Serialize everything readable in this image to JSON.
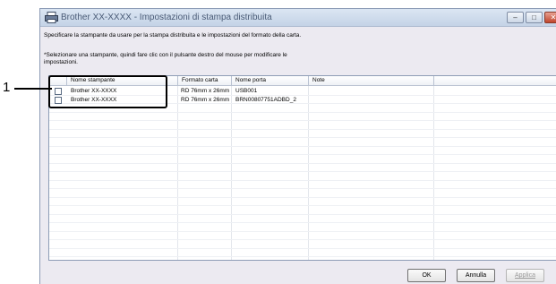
{
  "callout": {
    "number": "1"
  },
  "window": {
    "title": "Brother  XX-XXXX - Impostazioni di stampa distribuita",
    "controls": {
      "minimize": "–",
      "maximize": "□",
      "close": "✕"
    }
  },
  "description": {
    "line1": "Specificare la stampante da usare per la stampa distribuita e le impostazioni del formato della carta.",
    "line2": "*Selezionare una stampante, quindi fare clic con il pulsante destro del mouse per modificare le",
    "line3": "impostazioni."
  },
  "table": {
    "columns": [
      "Nome stampante",
      "Formato carta",
      "Nome porta",
      "Note"
    ],
    "rows": [
      {
        "checked": false,
        "printer": "Brother  XX-XXXX",
        "paper": "RD 76mm x 26mm",
        "port": "USB001",
        "note": ""
      },
      {
        "checked": false,
        "printer": "Brother  XX-XXXX",
        "paper": "RD 76mm x 26mm",
        "port": "BRN00807751ADBD_2",
        "note": ""
      }
    ]
  },
  "buttons": {
    "ok": "OK",
    "cancel": "Annulla",
    "apply": "Applica"
  },
  "icons": {
    "window_icon": "printer-icon"
  }
}
